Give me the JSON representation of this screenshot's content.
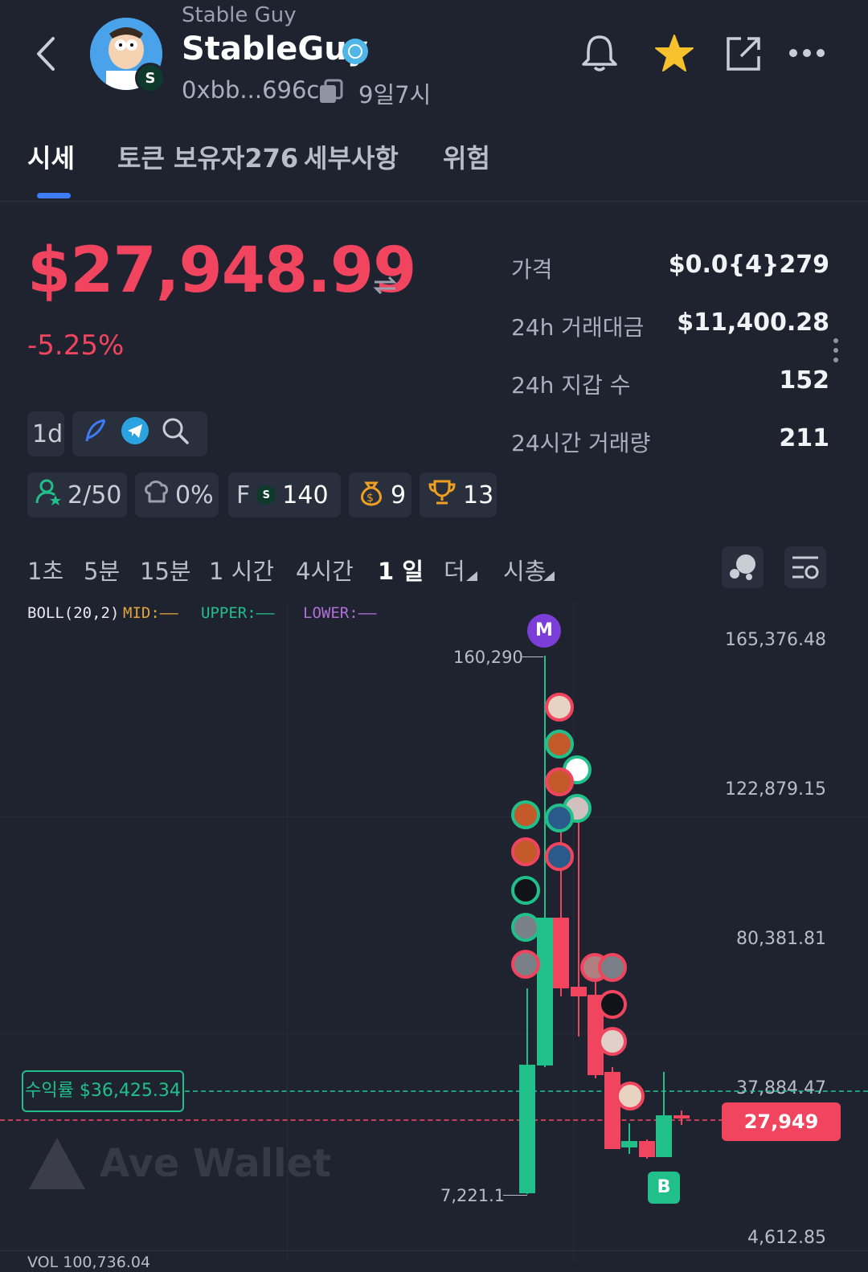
{
  "header": {
    "subtitle": "Stable Guy",
    "name": "StableGuy",
    "address": "0xbb...696c",
    "age": "9일7시"
  },
  "tabs": [
    {
      "label": "시세",
      "active": true
    },
    {
      "label": "토큰 보유자276",
      "active": false
    },
    {
      "label": "세부사항",
      "active": false
    },
    {
      "label": "위험",
      "active": false
    }
  ],
  "price": {
    "main": "$27,948.99",
    "change": "-5.25%",
    "swap_icon": "swap-arrows-icon"
  },
  "stats": [
    {
      "label": "가격",
      "value": "$0.0{4}279"
    },
    {
      "label": "24h 거래대금",
      "value": "$11,400.28"
    },
    {
      "label": "24h 지갑 수",
      "value": "152"
    },
    {
      "label": "24시간 거래량",
      "value": "211"
    }
  ],
  "tools": {
    "interval_chip": "1d"
  },
  "badges": {
    "holders": "2/50",
    "dev": "0%",
    "f_label": "F",
    "f_value": "140",
    "bag": "9",
    "trophy": "13"
  },
  "timeframes": [
    {
      "label": "1초",
      "active": false
    },
    {
      "label": "5분",
      "active": false
    },
    {
      "label": "15분",
      "active": false
    },
    {
      "label": "1 시간",
      "active": false
    },
    {
      "label": "4시간",
      "active": false
    },
    {
      "label": "1 일",
      "active": true
    },
    {
      "label": "더",
      "active": false
    },
    {
      "label": "시총",
      "active": false
    }
  ],
  "chart": {
    "boll": "BOLL(20,2)",
    "mid": "MID:——",
    "upper": "UPPER:——",
    "lower": "LOWER:——",
    "y_labels": [
      "165,376.48",
      "122,879.15",
      "80,381.81",
      "37,884.47",
      "4,612.85"
    ],
    "high_label": "160,290",
    "low_label": "7,221.1",
    "profit_label": "수익률 $36,425.34",
    "current_tag": "27,949",
    "marker_m": "M",
    "marker_b": "B",
    "watermark": "Ave Wallet",
    "volume_fragment": "VOL 100,736.04"
  },
  "colors": {
    "up": "#21c08a",
    "down": "#f0445f",
    "accent": "#3d7cf5",
    "bg": "#1f2330"
  }
}
